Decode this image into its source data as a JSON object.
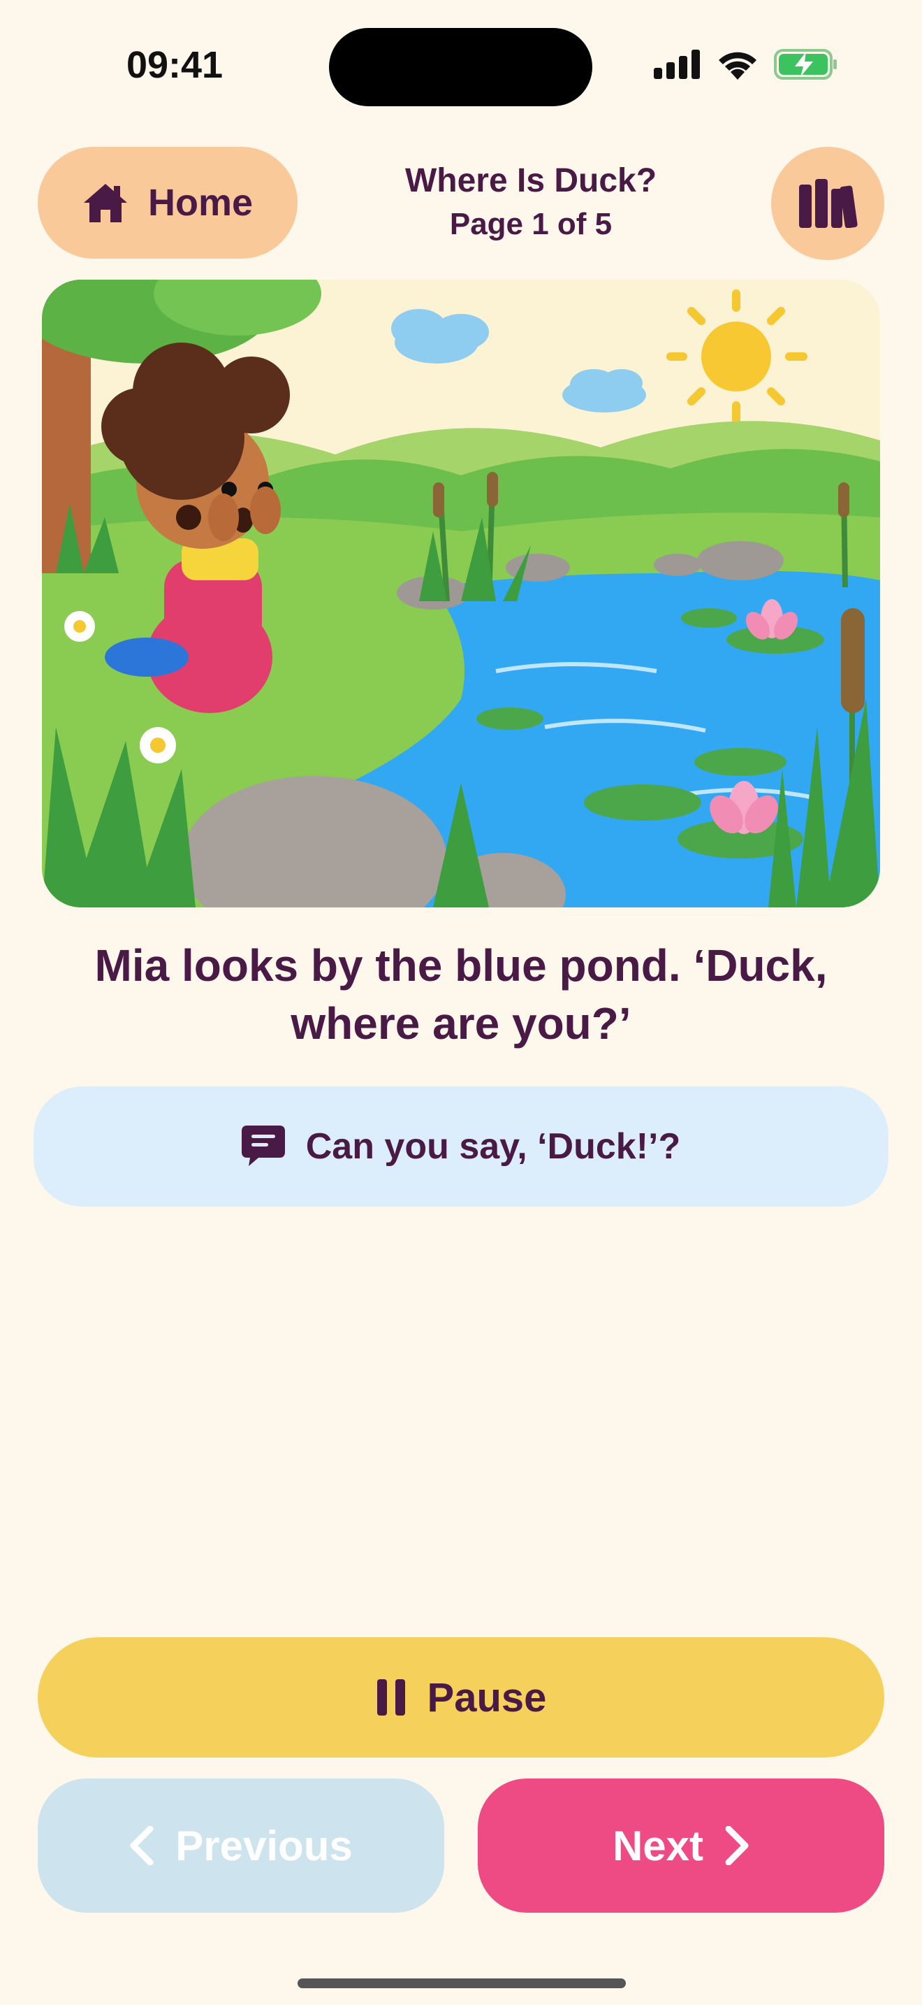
{
  "status_bar": {
    "time": "09:41"
  },
  "header": {
    "home_label": "Home",
    "book_title": "Where Is Duck?",
    "page_indicator": "Page 1 of 5"
  },
  "illustration": {
    "icon": "storybook-illustration"
  },
  "story": {
    "text": "Mia looks by the blue pond. ‘Duck, where are you?’"
  },
  "prompt": {
    "text": "Can you say, ‘Duck!’?",
    "icon": "speech-bubble-icon"
  },
  "controls": {
    "pause_label": "Pause",
    "previous_label": "Previous",
    "next_label": "Next",
    "previous_disabled": true
  },
  "colors": {
    "background": "#FEF7EC",
    "text": "#4A1A46",
    "home_button": "#F9C99A",
    "prompt_bg": "#DCEEFB",
    "pause_button": "#F5D05A",
    "previous_button": "#CDE3EE",
    "next_button": "#EE4B84"
  }
}
